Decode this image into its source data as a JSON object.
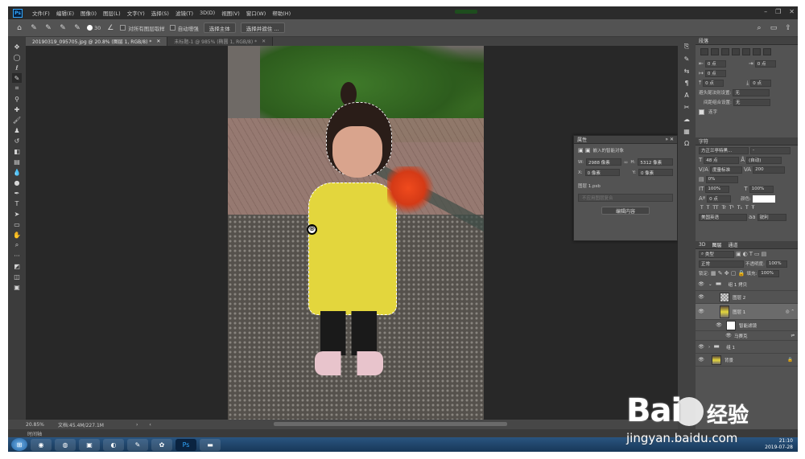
{
  "menubar": {
    "logo": "Ps",
    "items": [
      "文件(F)",
      "编辑(E)",
      "图像(I)",
      "图层(L)",
      "文字(Y)",
      "选择(S)",
      "滤镜(T)",
      "3D(D)",
      "视图(V)",
      "窗口(W)",
      "帮助(H)"
    ]
  },
  "options": {
    "brush_size": "30",
    "sample_all_layers": "对所有图层取样",
    "auto_enhance": "自动增强",
    "select_subject": "选择主体",
    "select_and_mask": "选择并遮住 ..."
  },
  "tabs": [
    {
      "label": "20190319_095705.jpg @ 20.8% (图层 1, RGB/8) *",
      "active": true
    },
    {
      "label": "未标题-1 @ 985% (椭圆 1, RGB/8) *",
      "active": false
    }
  ],
  "status": {
    "zoom": "20.85%",
    "doc": "文档:45.4M/227.1M"
  },
  "timeline": "时间轴",
  "paragraph": {
    "title": "段落",
    "indent_left": "0 点",
    "indent_right": "0 点",
    "indent_first": "0 点",
    "space_before": "0 点",
    "space_after": "0 点",
    "kinsoku_label": "避头尾法则设置:",
    "kinsoku_value": "无",
    "spacing_label": "间距组合设置:",
    "spacing_value": "无",
    "hyphenate": "连字"
  },
  "character": {
    "title": "字符",
    "font": "方正兰亭特黑...",
    "style": "-",
    "size": "48 点",
    "leading": "(自动)",
    "kerning": "度量标准",
    "tracking": "200",
    "tsume": "0%",
    "vscale": "100%",
    "hscale": "100%",
    "baseline": "0 点",
    "color_label": "颜色:",
    "style_buttons": [
      "T",
      "T",
      "TT",
      "Tr",
      "T¹",
      "T₁",
      "T",
      "Ŧ"
    ],
    "language": "美国英语",
    "antialias": "锐利"
  },
  "layers": {
    "tabs": [
      "3D",
      "图层",
      "通道"
    ],
    "filter": "类型",
    "blend": "正常",
    "opacity_label": "不透明度:",
    "opacity": "100%",
    "lock_label": "锁定:",
    "fill_label": "填充:",
    "fill": "100%",
    "items": [
      {
        "name": "组 1 拷贝",
        "kind": "folder",
        "selected": false
      },
      {
        "name": "图层 2",
        "kind": "layer",
        "selected": false
      },
      {
        "name": "图层 1",
        "kind": "smart",
        "selected": true
      },
      {
        "name": "智能滤镜",
        "kind": "filtermask",
        "selected": false
      },
      {
        "name": "马赛克",
        "kind": "filter",
        "selected": false
      },
      {
        "name": "组 1",
        "kind": "folder",
        "selected": false
      },
      {
        "name": "背景",
        "kind": "bg",
        "selected": false
      }
    ]
  },
  "properties": {
    "title": "属性",
    "type": "嵌入的智能对象",
    "w_label": "W:",
    "w": "2988 像素",
    "h_label": "H:",
    "h": "5312 像素",
    "x_label": "X:",
    "x": "0 像素",
    "y_label": "Y:",
    "y": "0 像素",
    "file": "图层 1.psb",
    "comps": "不应用图层复合",
    "edit": "编辑内容"
  },
  "tray": {
    "time": "21:10",
    "date": "2019-07-28"
  },
  "watermark": {
    "brand": "Bai",
    "brand2": "经验",
    "url": "jingyan.baidu.com"
  },
  "icons": {
    "move": "move-icon",
    "marquee": "marquee-icon",
    "lasso": "lasso-icon",
    "quick_select": "quick-select-icon"
  }
}
